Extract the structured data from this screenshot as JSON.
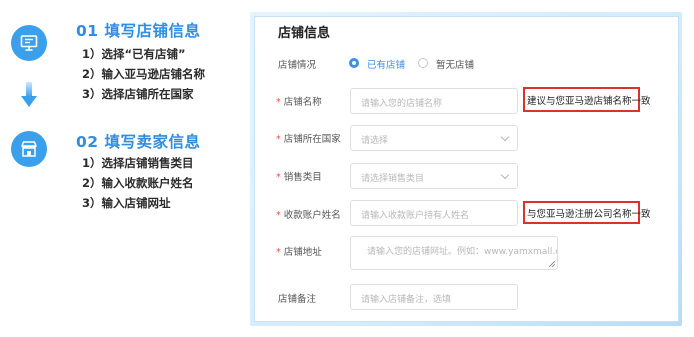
{
  "steps": [
    {
      "title": "01 填写店铺信息",
      "icon": "monitor-icon",
      "items": [
        "1）选择“已有店铺”",
        "2）输入亚马逊店铺名称",
        "3）选择店铺所在国家"
      ]
    },
    {
      "title": "02 填写卖家信息",
      "icon": "storefront-icon",
      "items": [
        "1）选择店铺销售类目",
        "2）输入收款账户姓名",
        "3）输入店铺网址"
      ]
    }
  ],
  "form": {
    "title": "店铺信息",
    "store_status": {
      "label": "店铺情况",
      "options": [
        {
          "label": "已有店铺",
          "selected": true
        },
        {
          "label": "暂无店铺",
          "selected": false
        }
      ]
    },
    "store_name": {
      "label": "店铺名称",
      "required": true,
      "placeholder": "请输入您的店铺名称"
    },
    "country": {
      "label": "店铺所在国家",
      "required": true,
      "placeholder": "请选择"
    },
    "category": {
      "label": "销售类目",
      "required": true,
      "placeholder": "请选择销售类目"
    },
    "account_name": {
      "label": "收款账户姓名",
      "required": true,
      "placeholder": "请输入收款账户持有人姓名"
    },
    "address": {
      "label": "店铺地址",
      "required": true,
      "placeholder": "请输入您的店铺网址。例如：www.yamxmall.com"
    },
    "remark": {
      "label": "店铺备注",
      "required": false,
      "placeholder": "请输入店铺备注，选填"
    }
  },
  "callouts": {
    "store_name": "建议与您亚马逊店铺名称一致",
    "account_name": "与您亚马逊注册公司名称一致"
  },
  "colors": {
    "accent": "#3e8fe8",
    "step_title": "#2f8ee0",
    "required": "#e8504a",
    "callout_border": "#d9332b"
  },
  "req_mark": "*"
}
